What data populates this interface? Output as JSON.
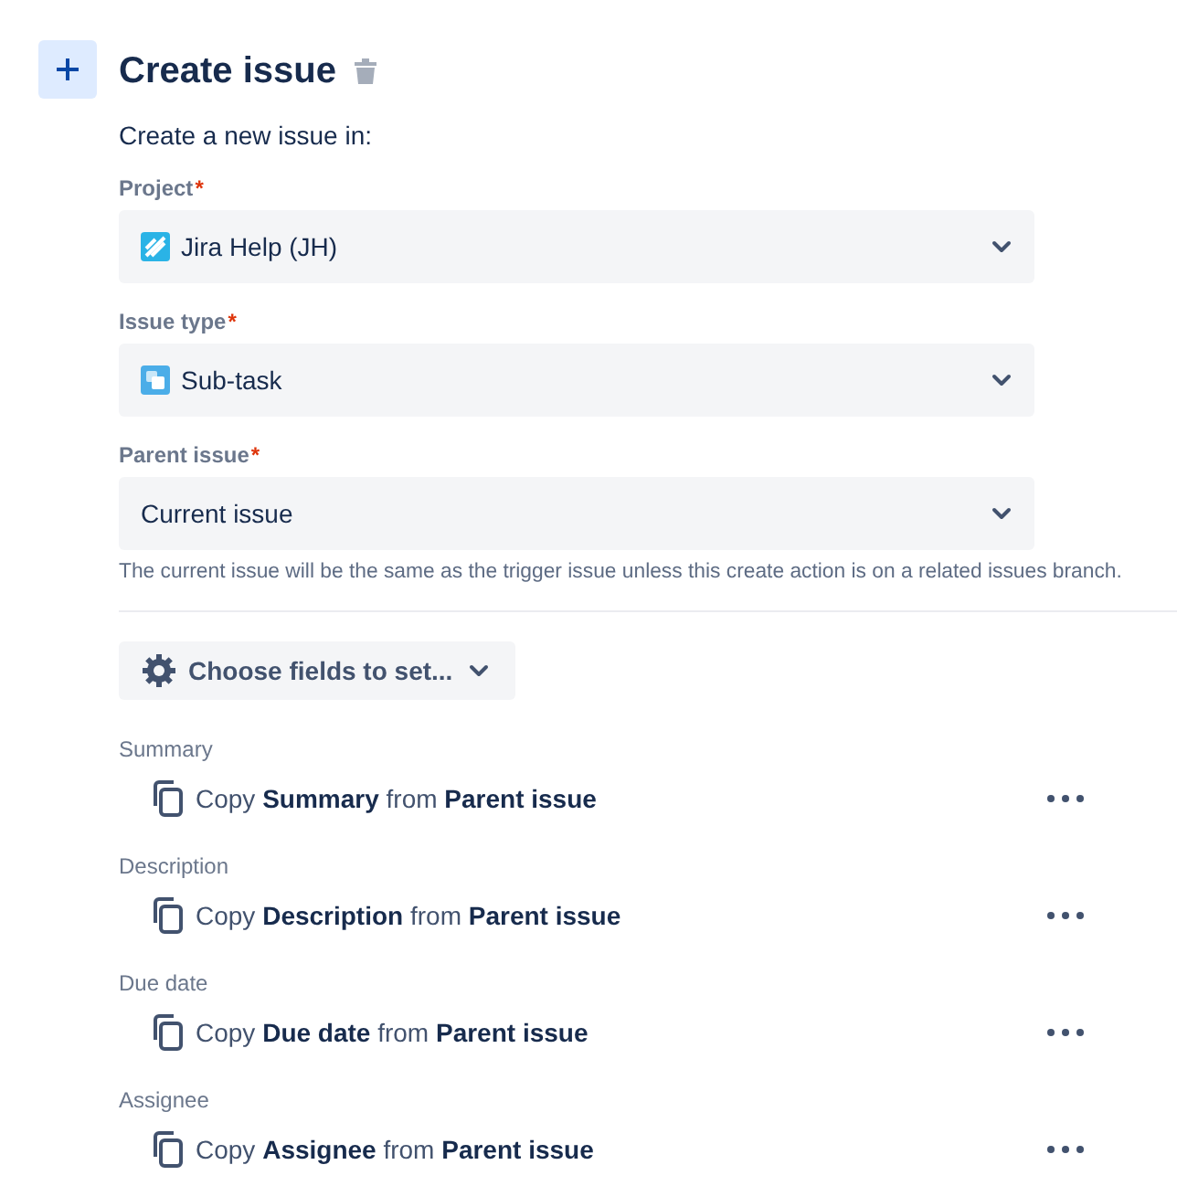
{
  "header": {
    "title": "Create issue"
  },
  "intro": "Create a new issue in:",
  "selects": [
    {
      "label": "Project",
      "required_mark": "*",
      "value": "Jira Help (JH)",
      "kind": "project"
    },
    {
      "label": "Issue type",
      "required_mark": "*",
      "value": "Sub-task",
      "kind": "subtask"
    },
    {
      "label": "Parent issue",
      "required_mark": "*",
      "value": "Current issue",
      "kind": "plain"
    }
  ],
  "helper": "The current issue will be the same as the trigger issue unless this create action is on a related issues branch.",
  "choose_button": "Choose fields to set...",
  "fields": [
    {
      "label": "Summary",
      "text": "Copy **Summary** from **Parent issue**"
    },
    {
      "label": "Description",
      "text": "Copy **Description** from **Parent issue**"
    },
    {
      "label": "Due date",
      "text": "Copy **Due date** from **Parent issue**"
    },
    {
      "label": "Assignee",
      "text": "Copy **Assignee** from **Parent issue**"
    }
  ]
}
